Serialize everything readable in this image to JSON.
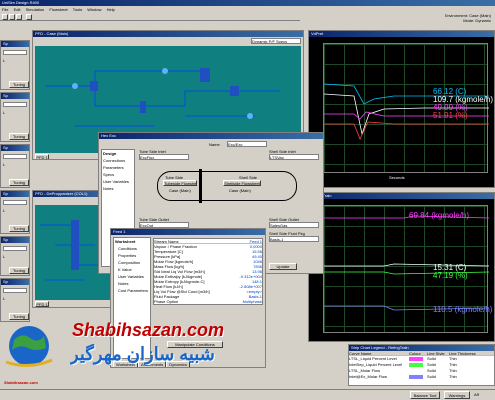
{
  "app": {
    "title": "UniSim Design R400",
    "menu": [
      "File",
      "Edit",
      "Simulation",
      "Flowsheet",
      "Tools",
      "Window",
      "Help"
    ],
    "env": "Environment: Case (Main)",
    "mode": "Mode: Dynamic"
  },
  "pfd_main": {
    "title": "PFD - Case (Main)",
    "view_label": "Dynamic P/F Specs"
  },
  "pfd_sub": {
    "title": "PFD - DeProppanizer (COL1)"
  },
  "tab_pfd1": "PFD 1",
  "left_panels": [
    {
      "title": "Sp",
      "tag": "L",
      "btn": "Tuning"
    },
    {
      "title": "Sp",
      "tag": "L",
      "btn": "Tuning"
    },
    {
      "title": "Sp",
      "tag": "L",
      "btn": "Tuning"
    },
    {
      "title": "Sp",
      "tag": "L",
      "btn": "Tuning"
    },
    {
      "title": "Sp",
      "tag": "L",
      "btn": "Tuning"
    },
    {
      "title": "Sp",
      "tag": "L",
      "btn": "Tuning"
    }
  ],
  "strip1": {
    "title": "VdPret",
    "values": [
      "66.12 (C)",
      "109.7 (kgmole/h)",
      "49.99 (%)",
      "51.91 (%)"
    ],
    "colors": [
      "#00c0ff",
      "#ffffff",
      "#ff40ff",
      "#ff4040"
    ],
    "xlabel": "Seconds"
  },
  "strip2": {
    "title": "RefingTrain",
    "values": [
      "69.84 (kgmole/h)",
      "15.31 (C)",
      "47.19 (%)",
      "110.5 (kgmole/h)"
    ],
    "colors": [
      "#ff40ff",
      "#ffffff",
      "#40ff40",
      "#8080ff"
    ]
  },
  "exchanger": {
    "title": "Hex Exc",
    "name_label": "Name",
    "name_value": "Exc/Exc",
    "tabs": [
      "Design",
      "Connections",
      "Parameters",
      "Specs",
      "User Variables",
      "Notes"
    ],
    "tube_inlet_label": "Tube Side Inlet",
    "tube_inlet_value": "ExcFlux",
    "shell_inlet_label": "Shell Side Inlet",
    "shell_inlet_value": "LTSVap",
    "tube_box": "Tube Side",
    "tube_btn": "Tubeside Flowsheet",
    "tube_sub": "Case (Main)",
    "shell_box": "Shell Side",
    "shell_btn": "Shellside Flowsheet",
    "shell_sub": "Case (Main)",
    "tube_outlet_label": "Tube Side Outlet",
    "tube_outlet_value": "ExcOut",
    "shell_outlet_label": "Shell Side Outlet",
    "shell_outlet_value": "SalesGas",
    "tube_pkg_label": "Tube Side Fluid Pkg",
    "tube_pkg_value": "Basis-1",
    "shell_pkg_label": "Shell Side Fluid Pkg",
    "shell_pkg_value": "Basis-1",
    "update_btn": "Update"
  },
  "feed": {
    "title": "Feed 1",
    "section": "Worksheet",
    "nav": [
      "Conditions",
      "Properties",
      "Composition",
      "K Value",
      "User Variables",
      "Notes",
      "Cost Parameters"
    ],
    "header": "Stream Name",
    "header_value": "Feed 1",
    "rows": [
      [
        "Vapour / Phase Fraction",
        "0.0000"
      ],
      [
        "Temperature [C]",
        "15.56"
      ],
      [
        "Pressure [kPa]",
        "49.40"
      ],
      [
        "Molar Flow [kgmole/h]",
        "1046"
      ],
      [
        "Mass Flow [kg/h]",
        "7836"
      ],
      [
        "Std Ideal Liq Vol Flow [m3/h]",
        "13.98"
      ],
      [
        "Molar Enthalpy [kJ/kgmole]",
        "-9.312e+004"
      ],
      [
        "Molar Entropy [kJ/kgmole-C]",
        "148.1"
      ],
      [
        "Heat Flow [kJ/h]",
        "-2.808e+007"
      ],
      [
        "Liq Vol Flow @Std Cond [m3/h]",
        "<empty>"
      ],
      [
        "Fluid Package",
        "Basis-1"
      ],
      [
        "Phase Option",
        "Multiphase"
      ]
    ],
    "button": "Manipulate Conditions",
    "tabs": [
      "Worksheet",
      "Attachments",
      "Dynamics"
    ]
  },
  "legend": {
    "title": "Strip Chart Legend - RefingTrain",
    "headers": [
      "Curve Name",
      "Colour",
      "Line Style",
      "Line Thickness"
    ],
    "rows": [
      [
        "LTSL_Liquid Percent Level",
        "Solid",
        "Thin",
        "#ff40ff"
      ],
      [
        "InletSep_Liquid Percent Level",
        "Solid",
        "Thin",
        "#40ff40"
      ],
      [
        "LTSL_Molar Flow",
        "Solid",
        "Thin",
        "#ffffff"
      ],
      [
        "Inlet@Ex_Molar Flow",
        "Solid",
        "Thin",
        "#8080ff"
      ]
    ]
  },
  "watermark": {
    "brand": "Shabihsazan.com",
    "persian": "شبیه سازان مهرگیر",
    "logo": "Shabihsazan.com"
  },
  "status": {
    "items": [
      "Balance Tool",
      "Warnings",
      "Aff"
    ]
  }
}
